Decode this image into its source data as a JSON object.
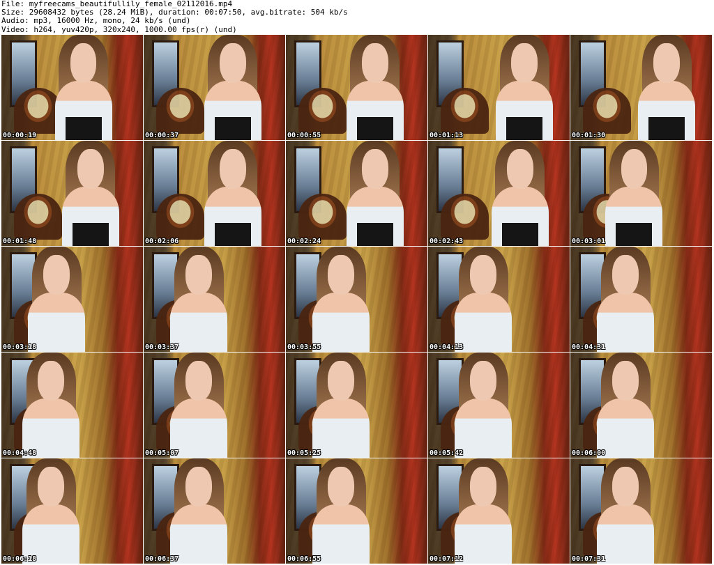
{
  "header": {
    "line1": "File: myfreecams_beautifullily_female_02112016.mp4",
    "line2": "Size: 29608432 bytes (28.24 MiB), duration: 00:07:50, avg.bitrate: 504 kb/s",
    "line3": "Audio: mp3, 16000 Hz, mono, 24 kb/s (und)",
    "line4": "Video: h264, yuv420p, 320x240, 1000.00 fps(r) (und)"
  },
  "thumbnails": [
    "00:00:19",
    "00:00:37",
    "00:00:55",
    "00:01:13",
    "00:01:30",
    "00:01:48",
    "00:02:06",
    "00:02:24",
    "00:02:43",
    "00:03:01",
    "00:03:18",
    "00:03:37",
    "00:03:55",
    "00:04:13",
    "00:04:31",
    "00:04:48",
    "00:05:07",
    "00:05:25",
    "00:05:42",
    "00:06:00",
    "00:06:18",
    "00:06:37",
    "00:06:55",
    "00:07:12",
    "00:07:31"
  ]
}
